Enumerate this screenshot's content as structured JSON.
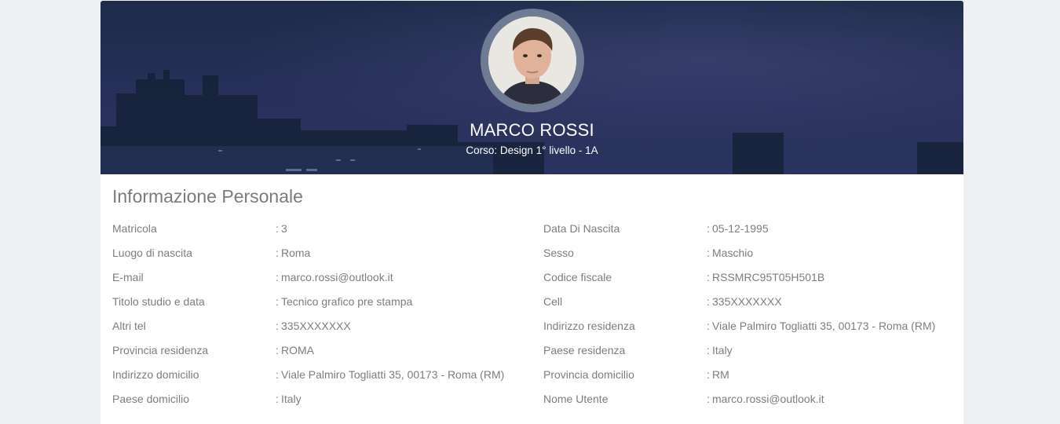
{
  "profile": {
    "name": "MARCO ROSSI",
    "course": "Corso: Design 1° livello - 1A"
  },
  "section_title": "Informazione Personale",
  "separator": ":",
  "left_fields": [
    {
      "label": "Matricola",
      "value": "3"
    },
    {
      "label": "Luogo di nascita",
      "value": "Roma"
    },
    {
      "label": "E-mail",
      "value": "marco.rossi@outlook.it"
    },
    {
      "label": "Titolo studio e data",
      "value": "Tecnico grafico pre stampa"
    },
    {
      "label": "Altri tel",
      "value": "335XXXXXXX"
    },
    {
      "label": "Provincia residenza",
      "value": "ROMA"
    },
    {
      "label": "Indirizzo domicilio",
      "value": "Viale Palmiro Togliatti 35, 00173 - Roma (RM)"
    },
    {
      "label": "Paese domicilio",
      "value": "Italy"
    }
  ],
  "right_fields": [
    {
      "label": "Data Di Nascita",
      "value": "05-12-1995"
    },
    {
      "label": "Sesso",
      "value": "Maschio"
    },
    {
      "label": "Codice fiscale",
      "value": "RSSMRC95T05H501B"
    },
    {
      "label": "Cell",
      "value": "335XXXXXXX"
    },
    {
      "label": "Indirizzo residenza",
      "value": "Viale Palmiro Togliatti 35, 00173 - Roma (RM)"
    },
    {
      "label": "Paese residenza",
      "value": "Italy"
    },
    {
      "label": "Provincia domicilio",
      "value": "RM"
    },
    {
      "label": "Nome Utente",
      "value": "marco.rossi@outlook.it"
    }
  ],
  "colors": {
    "page_bg": "#eef0f4",
    "banner_bg": "#222d4d",
    "text_muted": "#7d7d7d"
  }
}
